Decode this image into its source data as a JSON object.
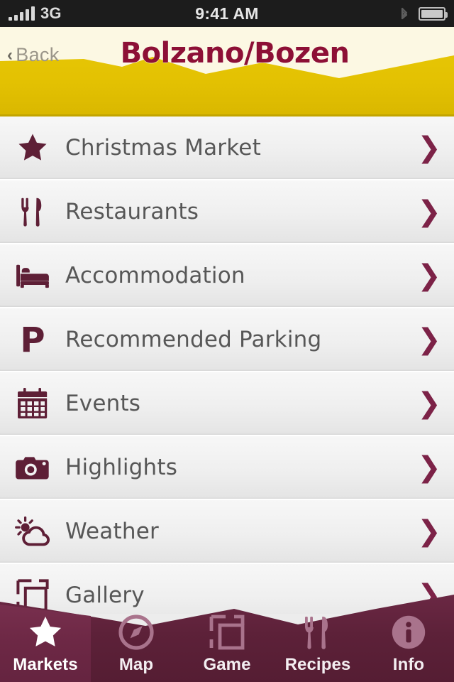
{
  "statusbar": {
    "carrier": "3G",
    "time": "9:41 AM",
    "signal_icon": "signal-bars-icon",
    "bluetooth_icon": "bluetooth-icon",
    "battery_icon": "battery-icon"
  },
  "header": {
    "back_label": "Back",
    "back_chevron": "‹",
    "title": "Bolzano/Bozen",
    "title_color": "#8d1036",
    "ivory_color": "#fcf8e3",
    "accent_yellow": "#e3c102"
  },
  "list": {
    "chevron": "❯",
    "items": [
      {
        "label": "Christmas Market",
        "icon": "star-icon"
      },
      {
        "label": "Restaurants",
        "icon": "fork-knife-icon"
      },
      {
        "label": "Accommodation",
        "icon": "bed-icon"
      },
      {
        "label": "Recommended Parking",
        "icon": "parking-p-icon"
      },
      {
        "label": "Events",
        "icon": "calendar-icon"
      },
      {
        "label": "Highlights",
        "icon": "camera-icon"
      },
      {
        "label": "Weather",
        "icon": "sun-cloud-icon"
      },
      {
        "label": "Gallery",
        "icon": "gallery-frames-icon"
      }
    ]
  },
  "tabbar": {
    "background_color": "#5d2139",
    "active_index": 0,
    "tabs": [
      {
        "label": "Markets",
        "icon": "star-icon",
        "active": true
      },
      {
        "label": "Map",
        "icon": "compass-icon",
        "active": false
      },
      {
        "label": "Game",
        "icon": "cards-icon",
        "active": false
      },
      {
        "label": "Recipes",
        "icon": "fork-knife-icon",
        "active": false
      },
      {
        "label": "Info",
        "icon": "info-circle-icon",
        "active": false
      }
    ]
  }
}
